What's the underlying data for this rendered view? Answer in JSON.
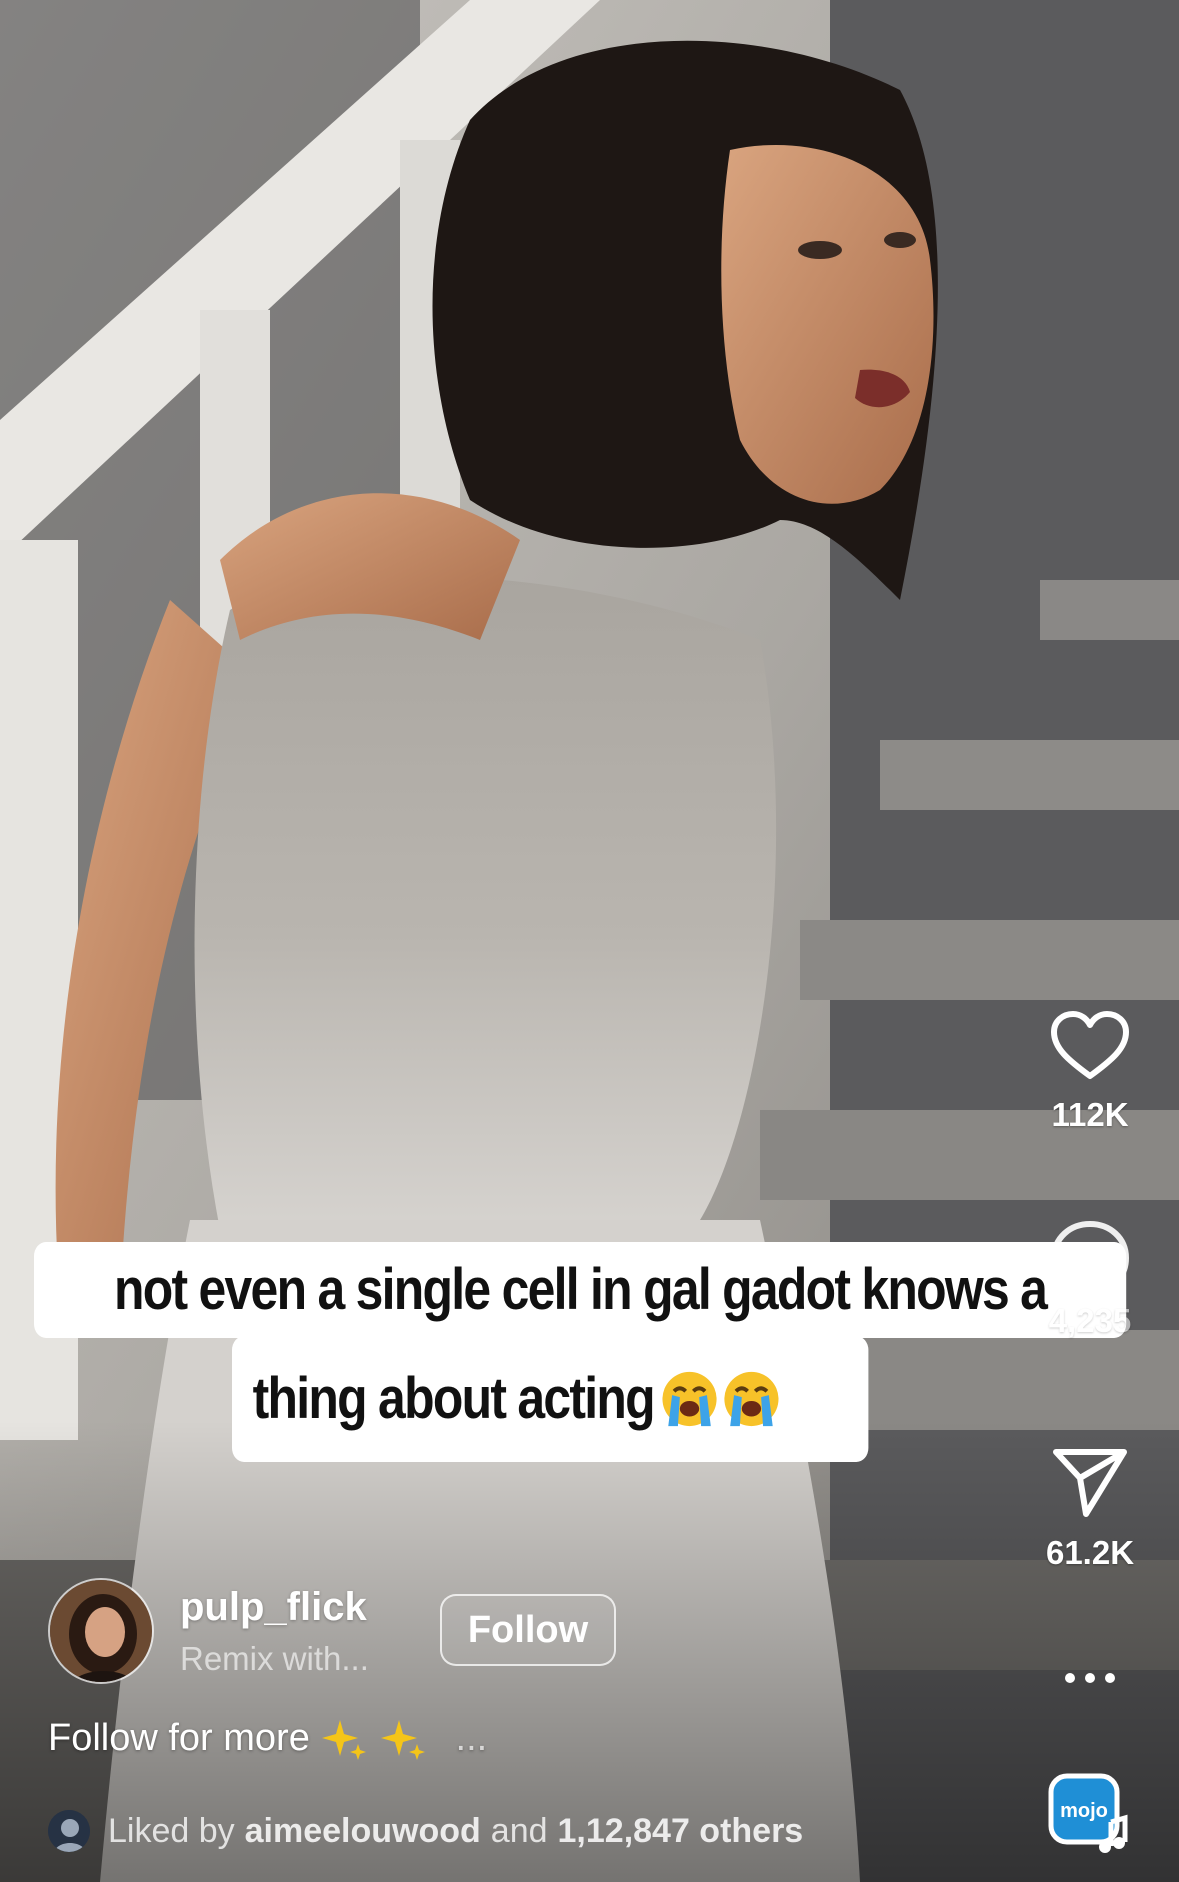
{
  "caption": {
    "line1": "not even a single cell in gal gadot knows a",
    "line2": "thing about acting",
    "emoji": [
      "loudly-crying-face",
      "loudly-crying-face"
    ]
  },
  "actions": {
    "likes": "112K",
    "comments": "4,235",
    "shares": "61.2K",
    "more_label": "..."
  },
  "author": {
    "username": "pulp_flick",
    "subtitle": "Remix with...",
    "follow_label": "Follow"
  },
  "description": {
    "text": "Follow for more",
    "more": "..."
  },
  "liked_by": {
    "prefix": "Liked by",
    "user": "aimeelouwood",
    "middle": "and",
    "count_text": "1,12,847 others"
  },
  "audio": {
    "badge_text": "mojo"
  },
  "colors": {
    "caption_bg": "#ffffff",
    "caption_text": "#111111",
    "icon": "#ffffff",
    "audio_badge": "#1f8fd6"
  }
}
